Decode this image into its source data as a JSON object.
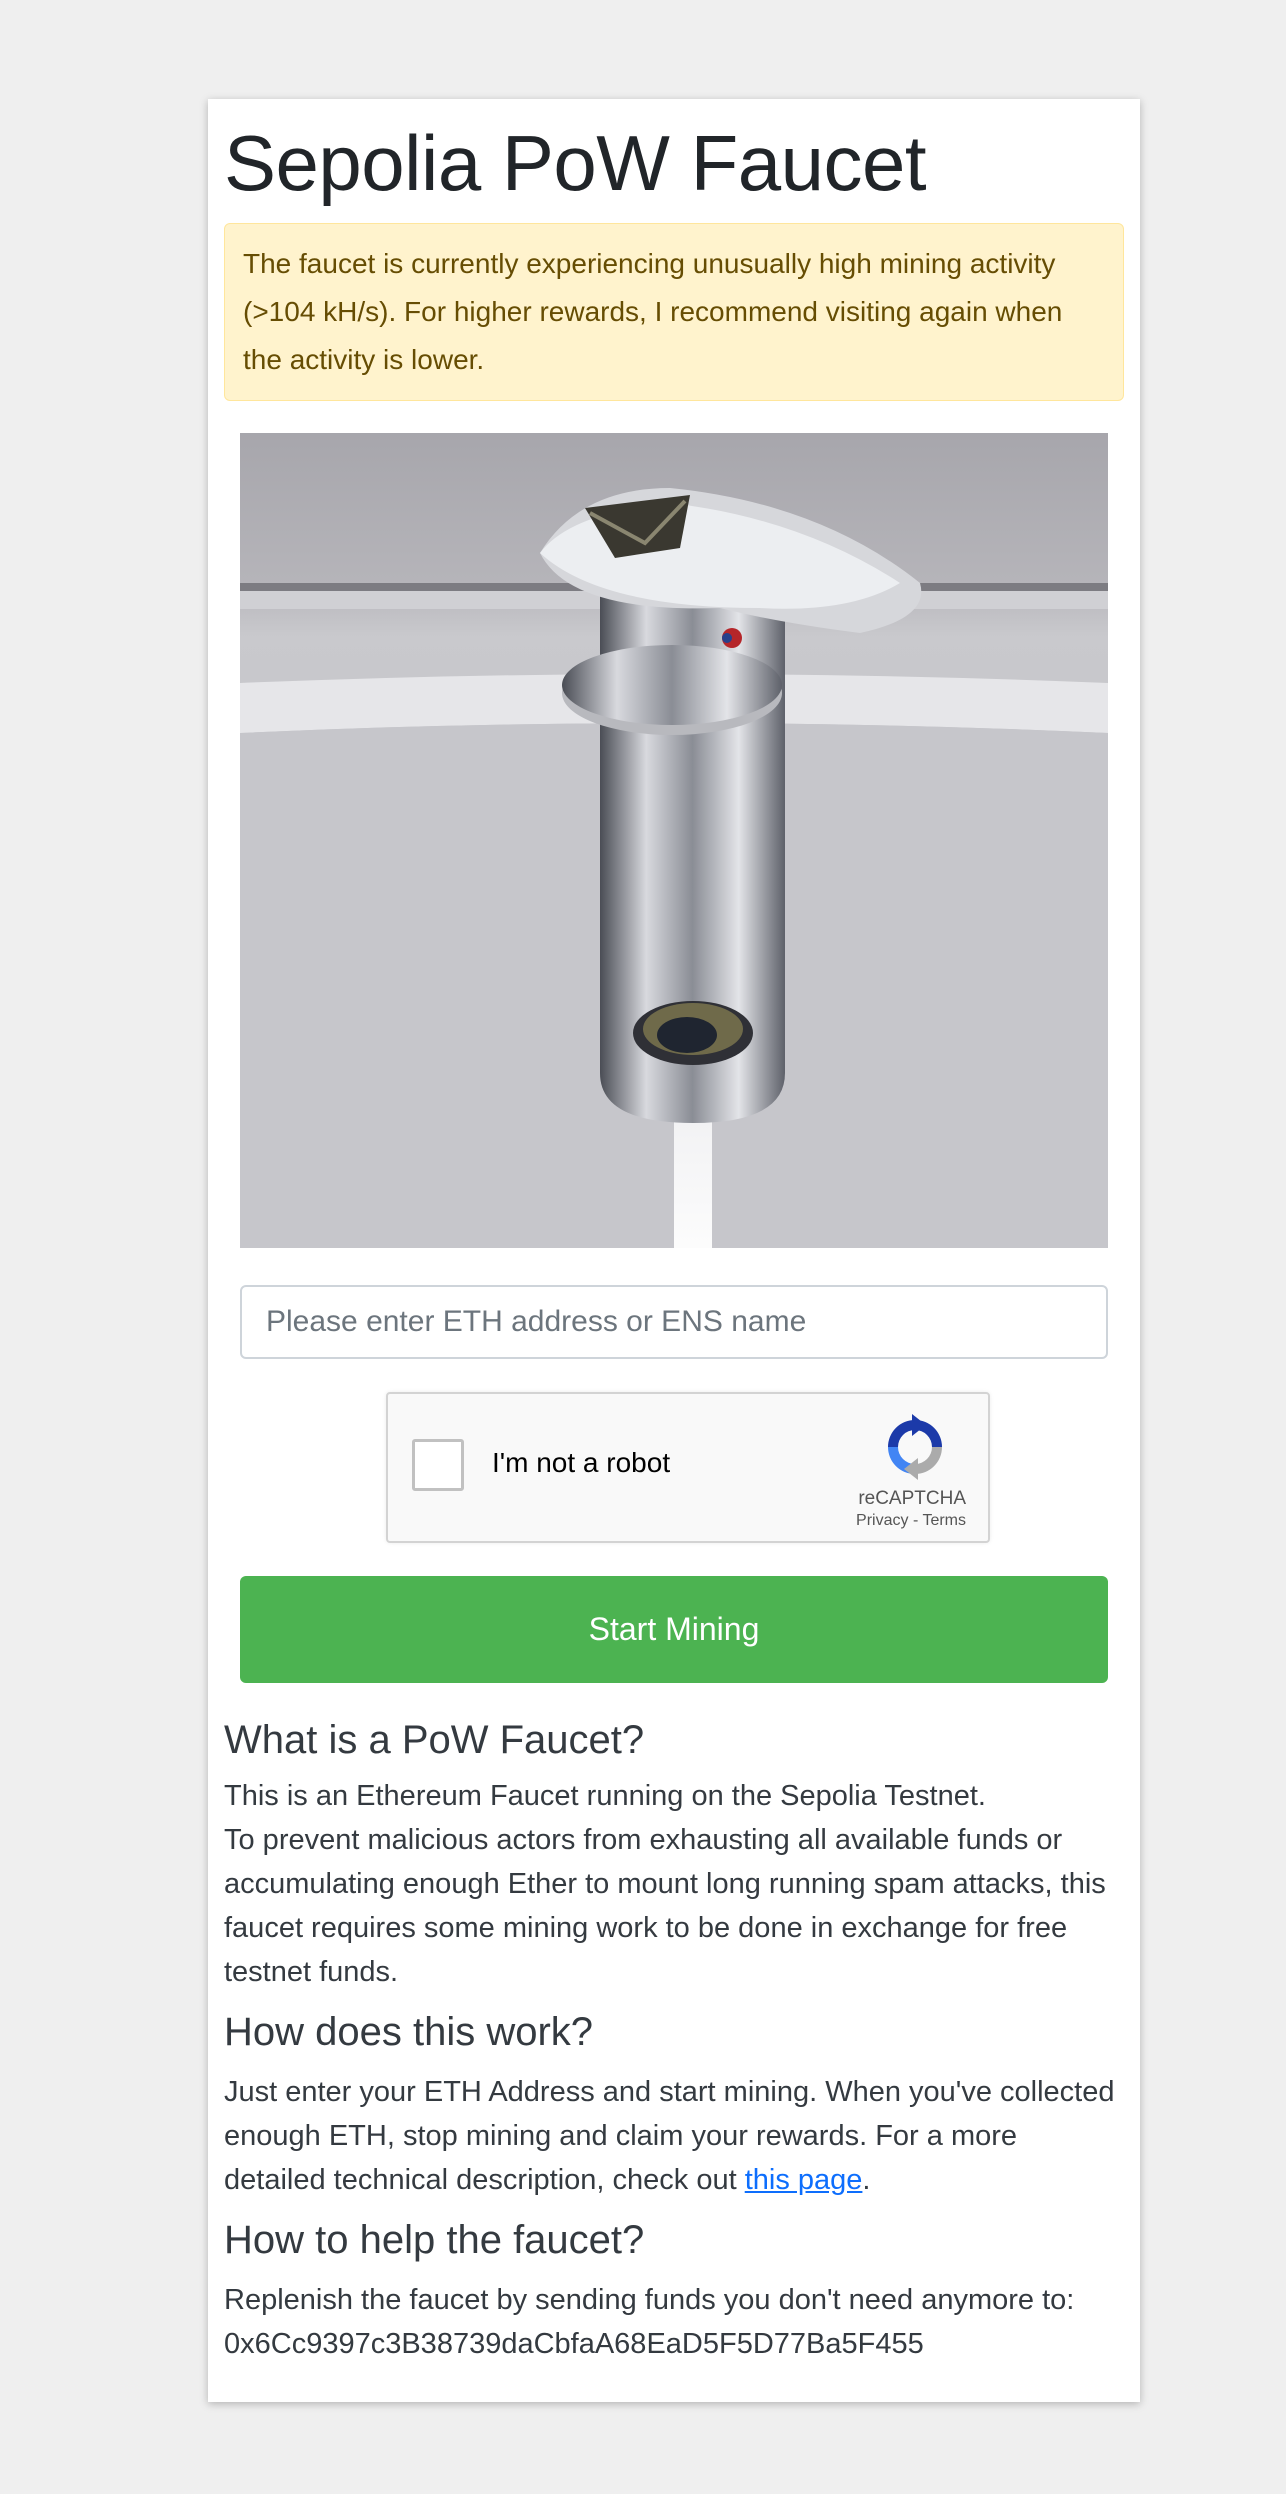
{
  "page": {
    "title": "Sepolia PoW Faucet"
  },
  "alert": {
    "text": "The faucet is currently experiencing unusually high mining activity (>104 kH/s). For higher rewards, I recommend visiting again when the activity is lower."
  },
  "address_input": {
    "placeholder": "Please enter ETH address or ENS name",
    "value": ""
  },
  "captcha": {
    "label": "I'm not a robot",
    "brand": "reCAPTCHA",
    "privacy": "Privacy",
    "separator": " - ",
    "terms": "Terms",
    "checked": false
  },
  "start_button": {
    "label": "Start Mining",
    "color": "#4cb351"
  },
  "sections": {
    "what": {
      "heading": "What is a PoW Faucet?",
      "line1": "This is an Ethereum Faucet running on the Sepolia Testnet.",
      "line2": "To prevent malicious actors from exhausting all available funds or accumulating enough Ether to mount long running spam attacks, this faucet requires some mining work to be done in exchange for free testnet funds."
    },
    "how": {
      "heading": "How does this work?",
      "text": "Just enter your ETH Address and start mining. When you've collected enough ETH, stop mining and claim your rewards. For a more detailed technical description, check out ",
      "link": "this page",
      "after": "."
    },
    "help": {
      "heading": "How to help the faucet?",
      "text": "Replenish the faucet by sending funds you don't need anymore to:",
      "address": "0x6Cc9397c3B38739daCbfaA68EaD5F5D77Ba5F455"
    }
  },
  "colors": {
    "background": "#efefef",
    "alert_bg": "#fff3cd",
    "alert_text": "#664d03",
    "link": "#0d6efd"
  },
  "icons": {
    "hero": "faucet-image",
    "captcha": "recaptcha-logo-icon"
  }
}
